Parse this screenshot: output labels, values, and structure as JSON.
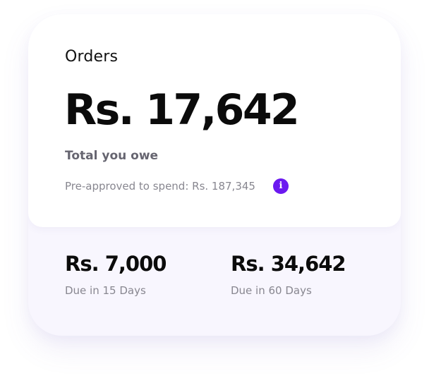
{
  "orders": {
    "title": "Orders",
    "total_amount": "Rs. 17,642",
    "total_label": "Total you owe",
    "preapproved_text": "Pre-approved to spend: Rs. 187,345",
    "info_icon": "info-icon",
    "info_icon_glyph": "i",
    "accent_color": "#6b19f0"
  },
  "dues": [
    {
      "amount": "Rs. 7,000",
      "label": "Due in 15 Days"
    },
    {
      "amount": "Rs. 34,642",
      "label": "Due in 60 Days"
    }
  ]
}
